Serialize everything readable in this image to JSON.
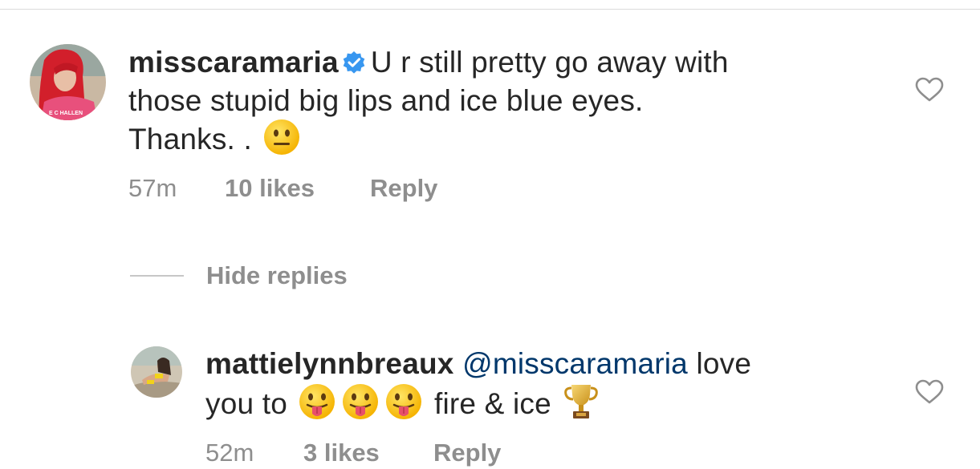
{
  "comment": {
    "username": "misscaramaria",
    "verified": true,
    "text_line1": "U r still pretty go away with",
    "text_line2": "those stupid big lips and ice blue eyes.",
    "text_line3": "Thanks. .",
    "emoji": "neutral-face",
    "time": "57m",
    "likes": "10 likes",
    "reply_label": "Reply",
    "avatar_text": "E C HALLEN"
  },
  "hide_replies": {
    "label": "Hide replies"
  },
  "reply": {
    "username": "mattielynnbreaux",
    "mention": "@misscaramaria",
    "text_line1_end": "love",
    "text_line2_start": "you to",
    "text_line2_mid": "fire & ice",
    "emojis": [
      "tongue-face",
      "tongue-face",
      "tongue-face",
      "trophy"
    ],
    "time": "52m",
    "likes": "3 likes",
    "reply_label": "Reply"
  },
  "colors": {
    "text": "#262626",
    "muted": "#8e8e8e",
    "mention": "#00376b",
    "verified": "#3897f0",
    "divider": "#dbdbdb"
  }
}
